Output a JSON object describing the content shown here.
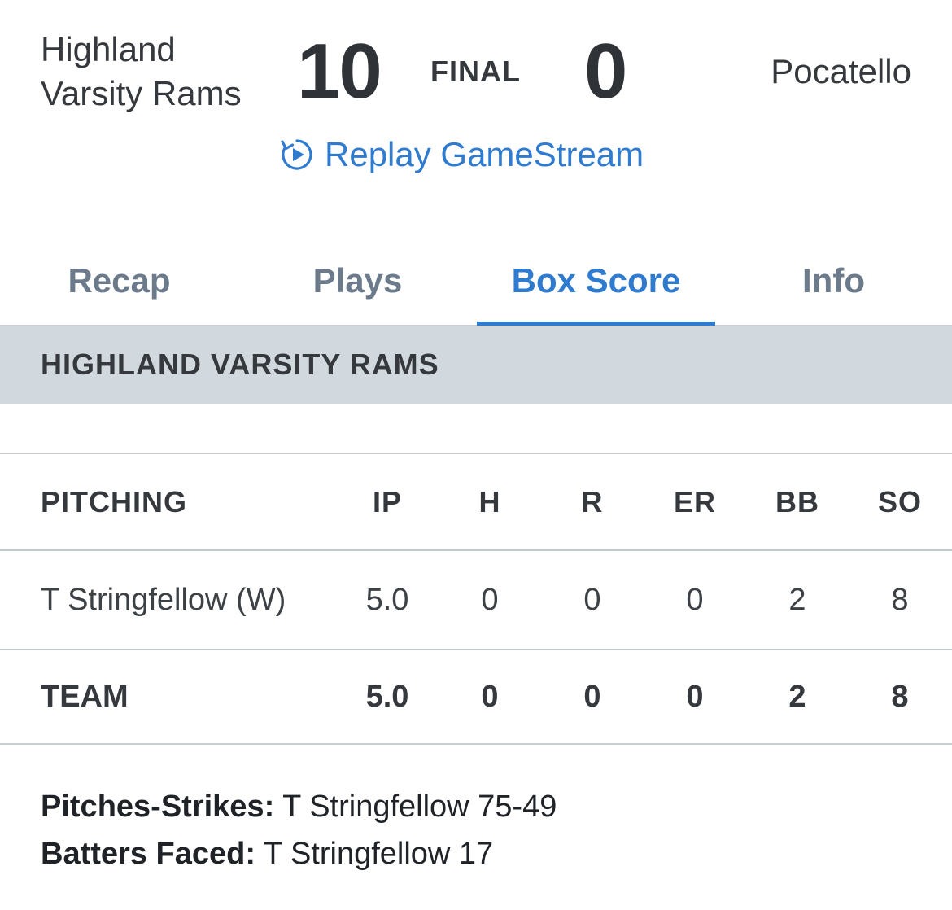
{
  "game": {
    "home_team": "Highland Varsity Rams",
    "home_score": "10",
    "status": "FINAL",
    "away_score": "0",
    "away_team": "Pocatello",
    "replay_label": "Replay GameStream",
    "replay_icon": "replay-icon"
  },
  "tabs": [
    {
      "label": "Recap",
      "active": false
    },
    {
      "label": "Plays",
      "active": false
    },
    {
      "label": "Box Score",
      "active": true
    },
    {
      "label": "Info",
      "active": false
    }
  ],
  "section": {
    "title": "HIGHLAND VARSITY RAMS"
  },
  "pitching_table": {
    "headers": [
      "PITCHING",
      "IP",
      "H",
      "R",
      "ER",
      "BB",
      "SO"
    ],
    "rows": [
      {
        "name": "T Stringfellow (W)",
        "ip": "5.0",
        "h": "0",
        "r": "0",
        "er": "0",
        "bb": "2",
        "so": "8"
      }
    ],
    "totals": {
      "name": "TEAM",
      "ip": "5.0",
      "h": "0",
      "r": "0",
      "er": "0",
      "bb": "2",
      "so": "8"
    }
  },
  "notes": [
    {
      "label": "Pitches-Strikes:",
      "value": " T Stringfellow 75-49"
    },
    {
      "label": "Batters Faced:",
      "value": " T Stringfellow 17"
    }
  ],
  "colors": {
    "accent": "#2f7bd0",
    "inactive_tab": "#6c7b8b",
    "section_bg": "#d1d8de",
    "text": "#35393d"
  }
}
